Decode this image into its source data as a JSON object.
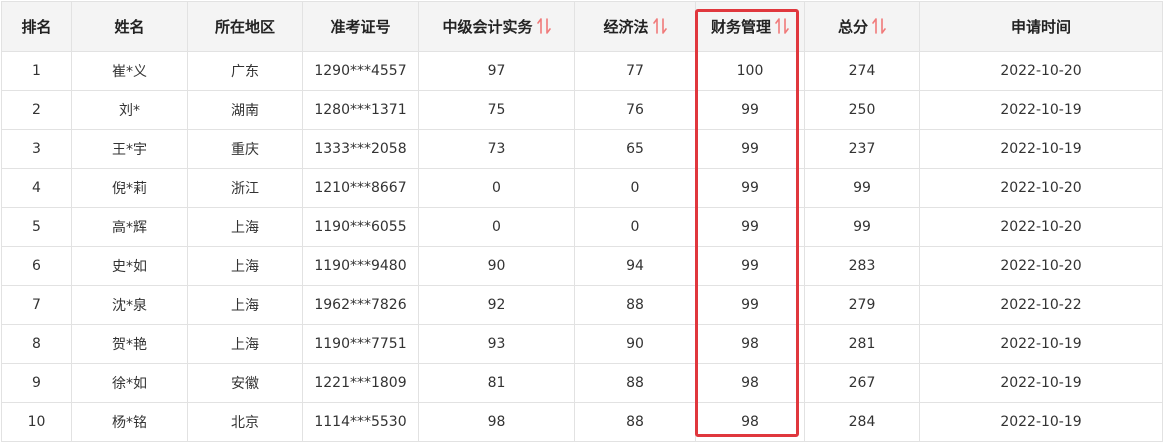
{
  "accent_color": "#e0373d",
  "sort_icon_color": "#f07a7a",
  "columns": [
    {
      "key": "rank",
      "label": "排名",
      "sortable": false
    },
    {
      "key": "name",
      "label": "姓名",
      "sortable": false
    },
    {
      "key": "region",
      "label": "所在地区",
      "sortable": false
    },
    {
      "key": "exam_id",
      "label": "准考证号",
      "sortable": false
    },
    {
      "key": "accounting",
      "label": "中级会计实务",
      "sortable": true
    },
    {
      "key": "economic_law",
      "label": "经济法",
      "sortable": true
    },
    {
      "key": "financial_mgmt",
      "label": "财务管理",
      "sortable": true
    },
    {
      "key": "total",
      "label": "总分",
      "sortable": true
    },
    {
      "key": "date",
      "label": "申请时间",
      "sortable": false
    }
  ],
  "rows": [
    [
      "1",
      "崔*义",
      "广东",
      "1290***4557",
      "97",
      "77",
      "100",
      "274",
      "2022-10-20"
    ],
    [
      "2",
      "刘*",
      "湖南",
      "1280***1371",
      "75",
      "76",
      "99",
      "250",
      "2022-10-19"
    ],
    [
      "3",
      "王*宇",
      "重庆",
      "1333***2058",
      "73",
      "65",
      "99",
      "237",
      "2022-10-19"
    ],
    [
      "4",
      "倪*莉",
      "浙江",
      "1210***8667",
      "0",
      "0",
      "99",
      "99",
      "2022-10-20"
    ],
    [
      "5",
      "高*辉",
      "上海",
      "1190***6055",
      "0",
      "0",
      "99",
      "99",
      "2022-10-20"
    ],
    [
      "6",
      "史*如",
      "上海",
      "1190***9480",
      "90",
      "94",
      "99",
      "283",
      "2022-10-20"
    ],
    [
      "7",
      "沈*泉",
      "上海",
      "1962***7826",
      "92",
      "88",
      "99",
      "279",
      "2022-10-22"
    ],
    [
      "8",
      "贺*艳",
      "上海",
      "1190***7751",
      "93",
      "90",
      "98",
      "281",
      "2022-10-19"
    ],
    [
      "9",
      "徐*如",
      "安徽",
      "1221***1809",
      "81",
      "88",
      "98",
      "267",
      "2022-10-19"
    ],
    [
      "10",
      "杨*铭",
      "北京",
      "1114***5530",
      "98",
      "88",
      "98",
      "284",
      "2022-10-19"
    ]
  ]
}
